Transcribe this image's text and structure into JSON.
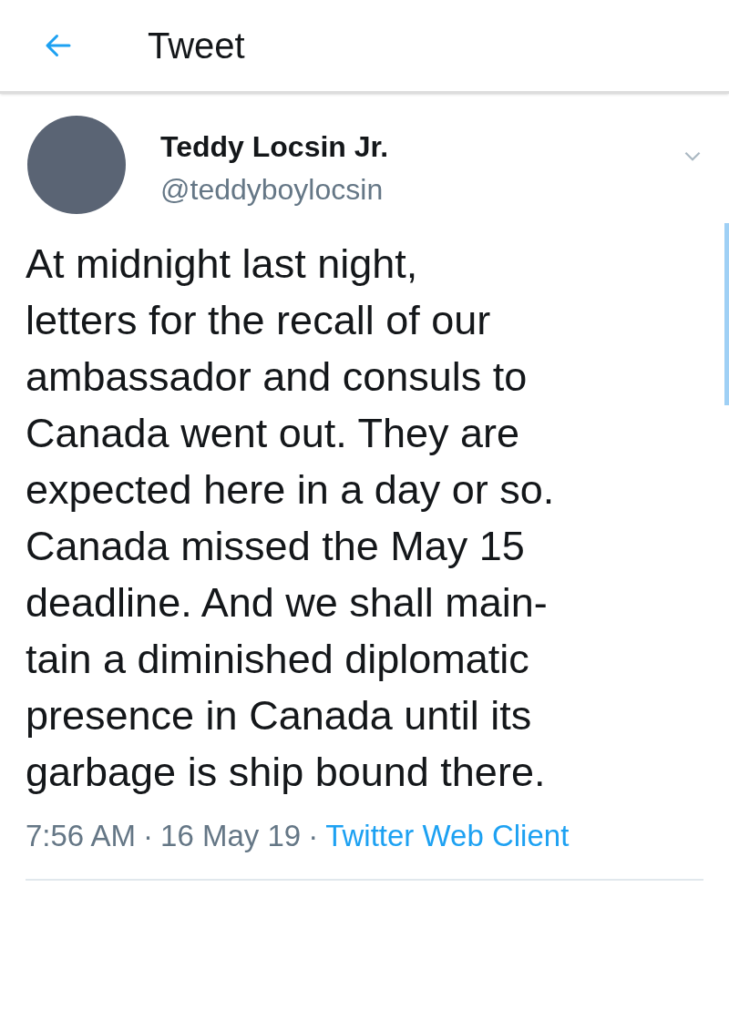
{
  "header": {
    "title": "Tweet"
  },
  "author": {
    "name": "Teddy Locsin Jr.",
    "handle": "@teddyboylocsin"
  },
  "tweet": {
    "lines": [
      "At midnight last night,",
      "letters for the recall of our",
      "ambassador and consuls to",
      "Canada went out. They are",
      "expected here in a day or so.",
      "Canada missed the May 15",
      "deadline. And we shall main-",
      "tain a diminished diplomatic",
      "presence in Canada until its",
      "garbage is ship bound there."
    ]
  },
  "meta": {
    "time": "7:56 AM",
    "separator": "·",
    "date": "16 May 19",
    "source": "Twitter Web Client"
  }
}
